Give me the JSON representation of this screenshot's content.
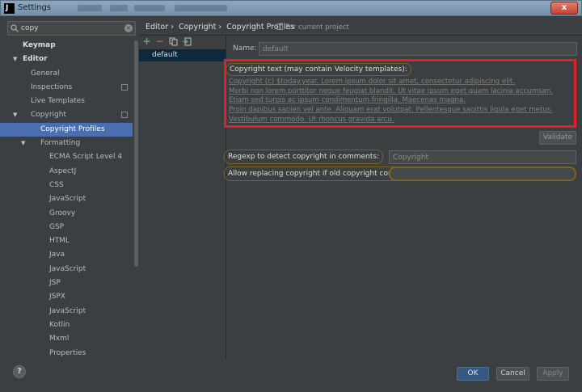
{
  "window": {
    "title": "Settings",
    "app_icon_letter": "J",
    "close_label": "x"
  },
  "search": {
    "value": "copy",
    "clear_glyph": "×"
  },
  "tree": [
    {
      "label": "Keymap",
      "indent": 0,
      "bold": true
    },
    {
      "label": "Editor",
      "indent": 0,
      "bold": true,
      "arrow": "▼"
    },
    {
      "label": "General",
      "indent": 1
    },
    {
      "label": "Inspections",
      "indent": 1,
      "project_icon": true
    },
    {
      "label": "Live Templates",
      "indent": 1
    },
    {
      "label": "Copyright",
      "indent": 1,
      "arrow": "▼",
      "project_icon": true
    },
    {
      "label": "Copyright Profiles",
      "indent": 2,
      "selected": true
    },
    {
      "label": "Formatting",
      "indent": 2,
      "arrow": "▼"
    },
    {
      "label": "ECMA Script Level 4",
      "indent": 3
    },
    {
      "label": "AspectJ",
      "indent": 3
    },
    {
      "label": "CSS",
      "indent": 3
    },
    {
      "label": "JavaScript",
      "indent": 3
    },
    {
      "label": "Groovy",
      "indent": 3
    },
    {
      "label": "GSP",
      "indent": 3
    },
    {
      "label": "HTML",
      "indent": 3
    },
    {
      "label": "Java",
      "indent": 3
    },
    {
      "label": "JavaScript",
      "indent": 3
    },
    {
      "label": "JSP",
      "indent": 3
    },
    {
      "label": "JSPX",
      "indent": 3
    },
    {
      "label": "JavaScript",
      "indent": 3
    },
    {
      "label": "Kotlin",
      "indent": 3
    },
    {
      "label": "Mxml",
      "indent": 3
    },
    {
      "label": "Properties",
      "indent": 3
    }
  ],
  "breadcrumb": [
    "Editor",
    "›",
    "Copyright",
    "›",
    "Copyright Profiles"
  ],
  "for_current_project": "For current project",
  "profiles": {
    "items": [
      "default"
    ]
  },
  "form": {
    "name_label": "Name:",
    "name_value": "default",
    "copyright_label": "Copyright text (may contain Velocity templates):",
    "copyright_lines": [
      "Copyright (c) $today.year. Lorem ipsum dolor sit amet, consectetur adipiscing elit.",
      "Morbi non lorem porttitor neque feugiat blandit. Ut vitae ipsum eget quam lacinia accumsan.",
      "Etiam sed turpis ac ipsum condimentum fringilla. Maecenas magna.",
      "Proin dapibus sapien vel ante. Aliquam erat volutpat. Pellentesque sagittis ligula eget metus.",
      "Vestibulum commodo. Ut rhoncus gravida arcu."
    ],
    "validate_label": "Validate",
    "regexp_label": "Regexp to detect copyright in comments:",
    "regexp_value": "Copyright",
    "replace_label": "Allow replacing copyright if old copyright contains:",
    "replace_value": ""
  },
  "buttons": {
    "help": "?",
    "ok": "OK",
    "cancel": "Cancel",
    "apply": "Apply"
  },
  "colors": {
    "selection": "#4b6eaf",
    "highlight_box": "#e0202a",
    "annotation_outline": "#7a6320"
  }
}
